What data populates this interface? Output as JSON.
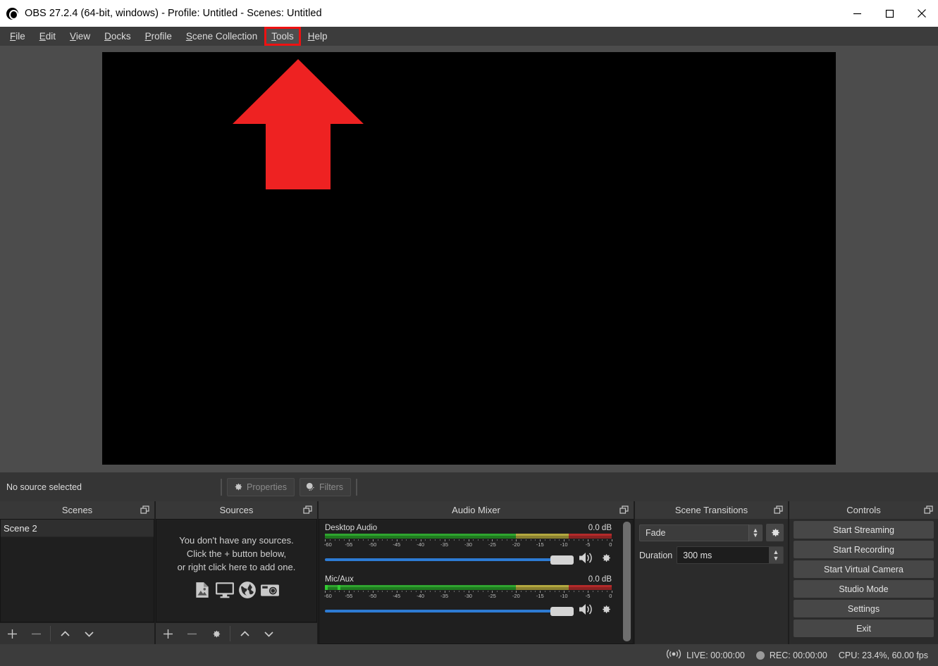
{
  "window": {
    "title": "OBS 27.2.4 (64-bit, windows) - Profile: Untitled - Scenes: Untitled",
    "app_icon": "obs-logo-icon",
    "minimize": "minimize-icon",
    "maximize": "maximize-icon",
    "close": "close-icon"
  },
  "menubar": {
    "items": [
      {
        "label": "File",
        "mnemonic": "F",
        "rest": "ile",
        "highlighted": false
      },
      {
        "label": "Edit",
        "mnemonic": "E",
        "rest": "dit",
        "highlighted": false
      },
      {
        "label": "View",
        "mnemonic": "V",
        "rest": "iew",
        "highlighted": false
      },
      {
        "label": "Docks",
        "mnemonic": "D",
        "rest": "ocks",
        "highlighted": false
      },
      {
        "label": "Profile",
        "mnemonic": "P",
        "rest": "rofile",
        "highlighted": false
      },
      {
        "label": "Scene Collection",
        "mnemonic": "S",
        "rest": "cene Collection",
        "highlighted": false
      },
      {
        "label": "Tools",
        "mnemonic": "T",
        "rest": "ools",
        "highlighted": true
      },
      {
        "label": "Help",
        "mnemonic": "H",
        "rest": "elp",
        "highlighted": false
      }
    ],
    "highlight_color": "#ee1111"
  },
  "preview": {
    "annotation": "red-up-arrow",
    "arrow_color": "#ee2222",
    "canvas_color": "#000000"
  },
  "source_toolbar": {
    "status": "No source selected",
    "properties_label": "Properties",
    "filters_label": "Filters"
  },
  "scenes": {
    "title": "Scenes",
    "items": [
      {
        "name": "Scene 2",
        "selected": true
      }
    ],
    "toolbar": [
      "add-scene",
      "remove-scene",
      "move-scene-up",
      "move-scene-down"
    ]
  },
  "sources": {
    "title": "Sources",
    "empty_lines": [
      "You don't have any sources.",
      "Click the + button below,",
      "or right click here to add one."
    ],
    "empty_icons": [
      "image-icon",
      "display-capture-icon",
      "browser-globe-icon",
      "camera-icon"
    ],
    "toolbar": [
      "add-source",
      "remove-source",
      "source-properties",
      "move-source-up",
      "move-source-down"
    ]
  },
  "mixer": {
    "title": "Audio Mixer",
    "tracks": [
      {
        "name": "Desktop Audio",
        "db": "0.0 dB",
        "volume_percent": 100,
        "level_percent": 0,
        "muted": false
      },
      {
        "name": "Mic/Aux",
        "db": "0.0 dB",
        "volume_percent": 100,
        "level_percent": 9,
        "muted": false
      }
    ],
    "scale_ticks": [
      "-60",
      "-55",
      "-50",
      "-45",
      "-40",
      "-35",
      "-30",
      "-25",
      "-20",
      "-15",
      "-10",
      "-5",
      "0"
    ],
    "scale_min": -60,
    "scale_max": 0
  },
  "transitions": {
    "title": "Scene Transitions",
    "selected_transition": "Fade",
    "duration_label": "Duration",
    "duration_value": "300 ms"
  },
  "controls": {
    "title": "Controls",
    "buttons": [
      "Start Streaming",
      "Start Recording",
      "Start Virtual Camera",
      "Studio Mode",
      "Settings",
      "Exit"
    ]
  },
  "statusbar": {
    "live_label": "LIVE: 00:00:00",
    "rec_label": "REC: 00:00:00",
    "cpu_label": "CPU: 23.4%, 60.00 fps",
    "broadcast_icon": "broadcast-icon",
    "record_icon": "record-dot-icon"
  }
}
